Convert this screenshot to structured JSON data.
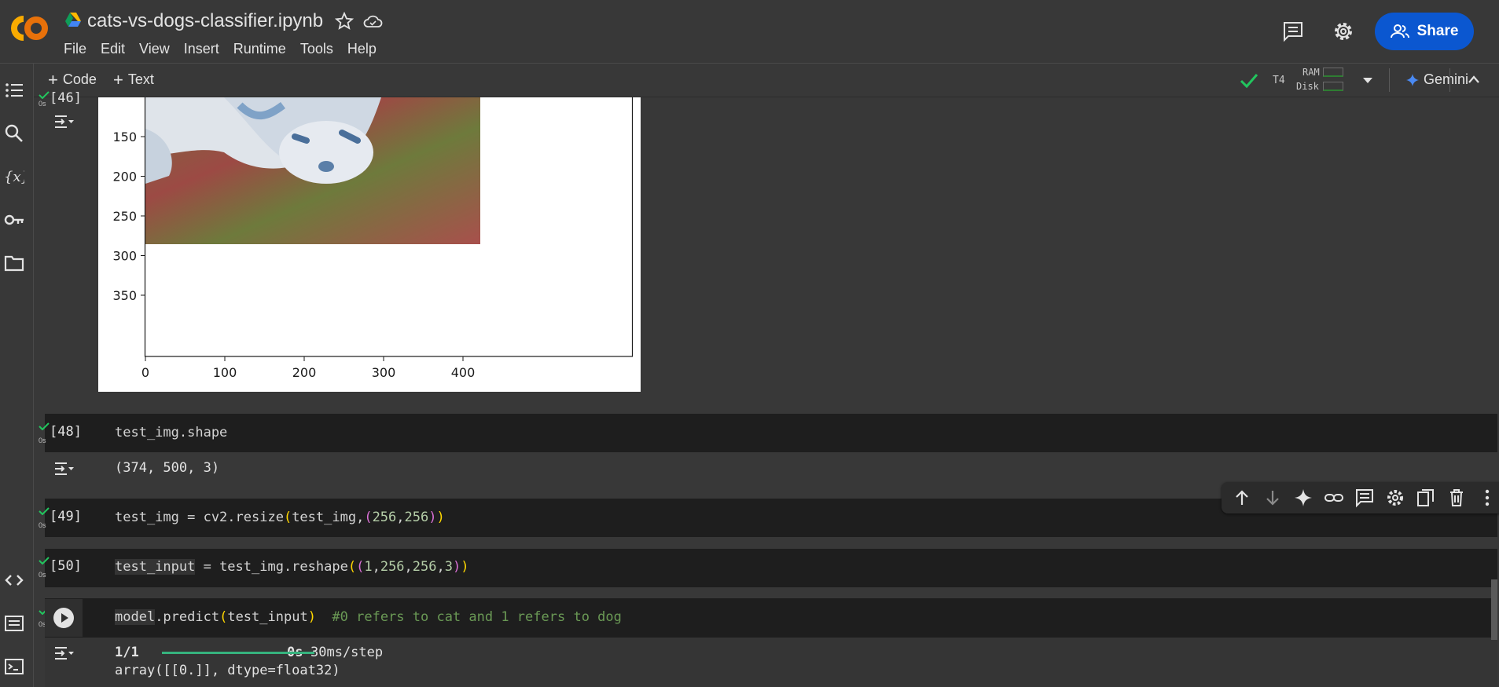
{
  "header": {
    "title": "cats-vs-dogs-classifier.ipynb",
    "menu": [
      "File",
      "Edit",
      "View",
      "Insert",
      "Runtime",
      "Tools",
      "Help"
    ],
    "share_label": "Share"
  },
  "toolbar": {
    "add_code": "Code",
    "add_text": "Text",
    "runtime_type": "T4",
    "ram_label": "RAM",
    "disk_label": "Disk",
    "gemini_label": "Gemini"
  },
  "cells": [
    {
      "exec": "[46]",
      "time": "0s",
      "plot": {
        "y_ticks": [
          "150",
          "200",
          "250",
          "300",
          "350"
        ],
        "x_ticks": [
          "0",
          "100",
          "200",
          "300",
          "400"
        ]
      }
    },
    {
      "exec": "[48]",
      "time": "0s",
      "code": "test_img.shape",
      "output": "(374, 500, 3)"
    },
    {
      "exec": "[49]",
      "time": "0s",
      "code_parts": [
        "test_img = cv2.resize",
        "(",
        "test_img,",
        "(",
        "256",
        ",",
        "256",
        ")",
        ")"
      ]
    },
    {
      "exec": "[50]",
      "time": "0s",
      "code_parts": [
        "test_input",
        " = test_img.reshape",
        "(",
        "(",
        "1",
        ",",
        "256",
        ",",
        "256",
        ",",
        "3",
        ")",
        ")"
      ]
    },
    {
      "time": "0s",
      "code_parts": [
        "model",
        ".predict",
        "(",
        "test_input",
        ")",
        "  #0 refers to cat and 1 refers to dog"
      ],
      "progress_label": "1/1",
      "progress_fraction": 1.0,
      "progress_time": "0s",
      "progress_rate": "30ms/step",
      "output": "array([[0.]], dtype=float32)"
    }
  ],
  "colors": {
    "accent": "#0b57d0",
    "check": "#22c55e",
    "comment": "#6a9955"
  }
}
